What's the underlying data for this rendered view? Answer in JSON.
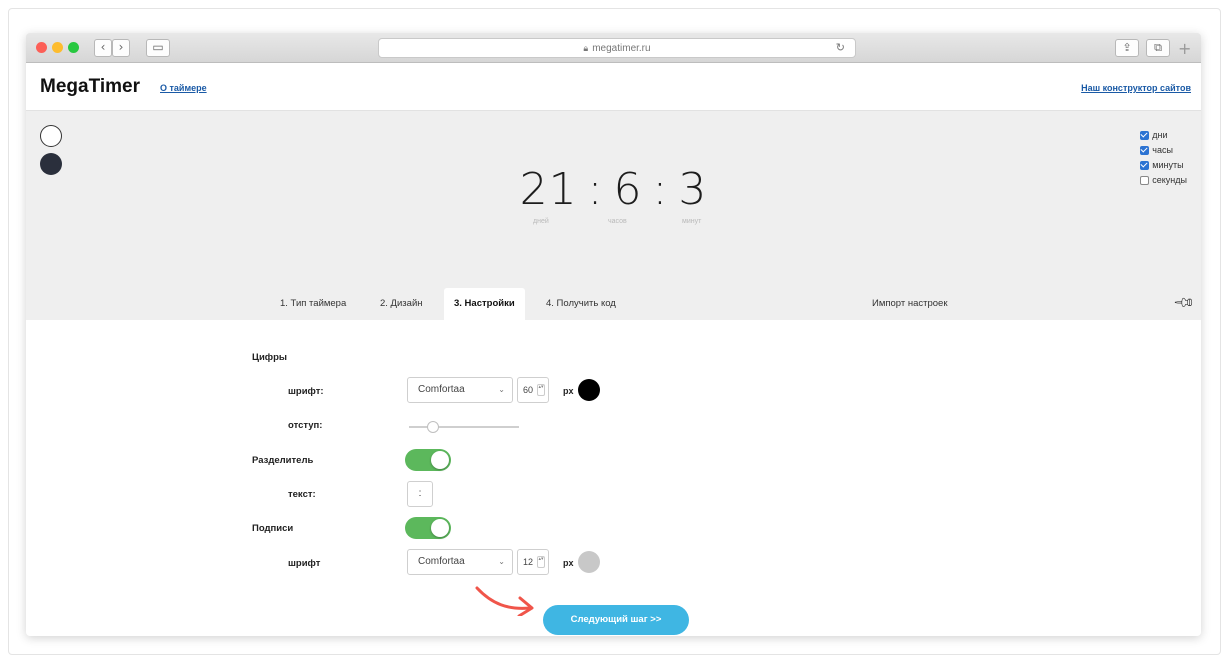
{
  "browser": {
    "url": "megatimer.ru",
    "controls": {
      "back": "‹",
      "forward": "›",
      "reload": "↻",
      "share": "⇪",
      "tabs": "⧉",
      "new_tab": "+"
    }
  },
  "header": {
    "brand": "MegaTimer",
    "about_link": "О таймере",
    "builder_link": "Наш конструктор сайтов"
  },
  "preview": {
    "timer": {
      "days": "21",
      "hours": "6",
      "minutes": "3",
      "separator": ":"
    },
    "sublabels": {
      "days": "дней",
      "hours": "часов",
      "minutes": "минут"
    },
    "color_swatches": [
      "#ffffff",
      "#2a2f3c"
    ],
    "units": [
      {
        "label": "дни",
        "checked": true
      },
      {
        "label": "часы",
        "checked": true
      },
      {
        "label": "минуты",
        "checked": true
      },
      {
        "label": "секунды",
        "checked": false
      }
    ]
  },
  "tabs": [
    {
      "label": "1. Тип таймера",
      "active": false
    },
    {
      "label": "2. Дизайн",
      "active": false
    },
    {
      "label": "3. Настройки",
      "active": true
    },
    {
      "label": "4. Получить код",
      "active": false
    },
    {
      "label": "Импорт настроек",
      "active": false
    }
  ],
  "settings": {
    "digits": {
      "title": "Цифры",
      "font_label": "шрифт:",
      "font_value": "Comfortaa",
      "size_value": "60",
      "unit": "px",
      "color": "#000000",
      "indent_label": "отступ:",
      "indent_level": 0.25
    },
    "divider": {
      "title": "Разделитель",
      "enabled": true,
      "text_label": "текст:",
      "text_value": ":"
    },
    "captions": {
      "title": "Подписи",
      "enabled": true,
      "font_label": "шрифт",
      "font_value": "Comfortaa",
      "size_value": "12",
      "unit": "px",
      "color": "#c8c8c8"
    },
    "next_button": "Следующий шаг >>"
  },
  "colors": {
    "accent": "#3fb6e3",
    "toggle_on": "#5cb85c",
    "link": "#1a5aa6",
    "arrow": "#f0554a"
  }
}
